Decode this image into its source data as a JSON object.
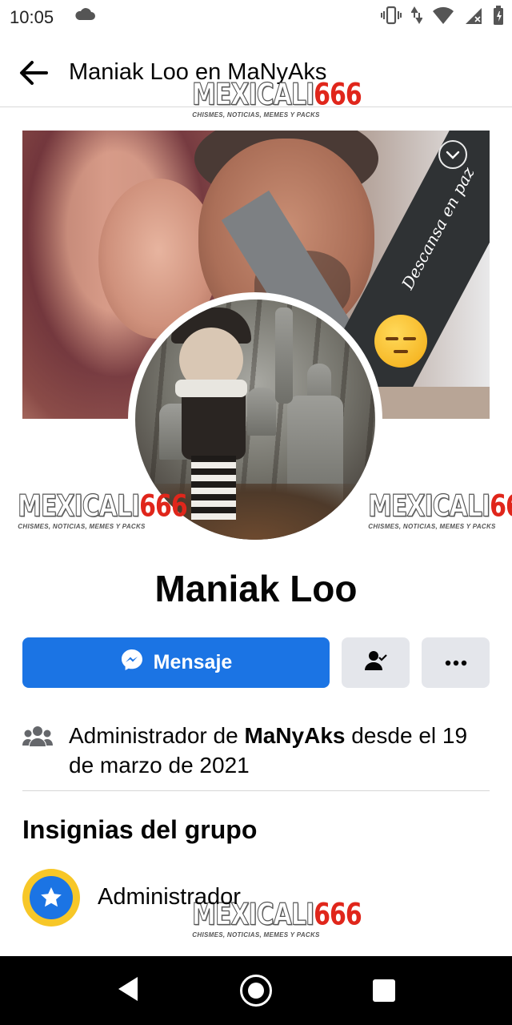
{
  "status_bar": {
    "time": "10:05",
    "icons": [
      "cloud-icon",
      "vibrate-icon",
      "data-arrows-icon",
      "wifi-icon",
      "signal-icon",
      "battery-icon"
    ]
  },
  "header": {
    "title": "Maniak Loo en MaNyAks",
    "back_icon": "arrow-left-icon"
  },
  "watermarks": {
    "brand_word": "MEXICALI",
    "brand_number": "666",
    "tagline": "CHISMES, NOTICIAS, MEMES Y PACKS"
  },
  "cover": {
    "ribbon_text": "Descansa en paz"
  },
  "profile": {
    "name": "Maniak Loo"
  },
  "actions": {
    "message_label": "Mensaje",
    "message_icon": "messenger-icon",
    "friend_icon": "person-check-icon",
    "more_icon": "more-horizontal-icon"
  },
  "admin_info": {
    "prefix": "Administrador de ",
    "group": "MaNyAks",
    "suffix": " desde el 19 de marzo de 2021",
    "icon": "group-icon"
  },
  "badges": {
    "title": "Insignias del grupo",
    "items": [
      {
        "label": "Administrador",
        "icon": "admin-star-icon"
      }
    ]
  },
  "colors": {
    "primary": "#1b74e4",
    "badge_yellow": "#f7c728",
    "button_gray": "#e4e6eb",
    "watermark_red": "#e0261b"
  }
}
